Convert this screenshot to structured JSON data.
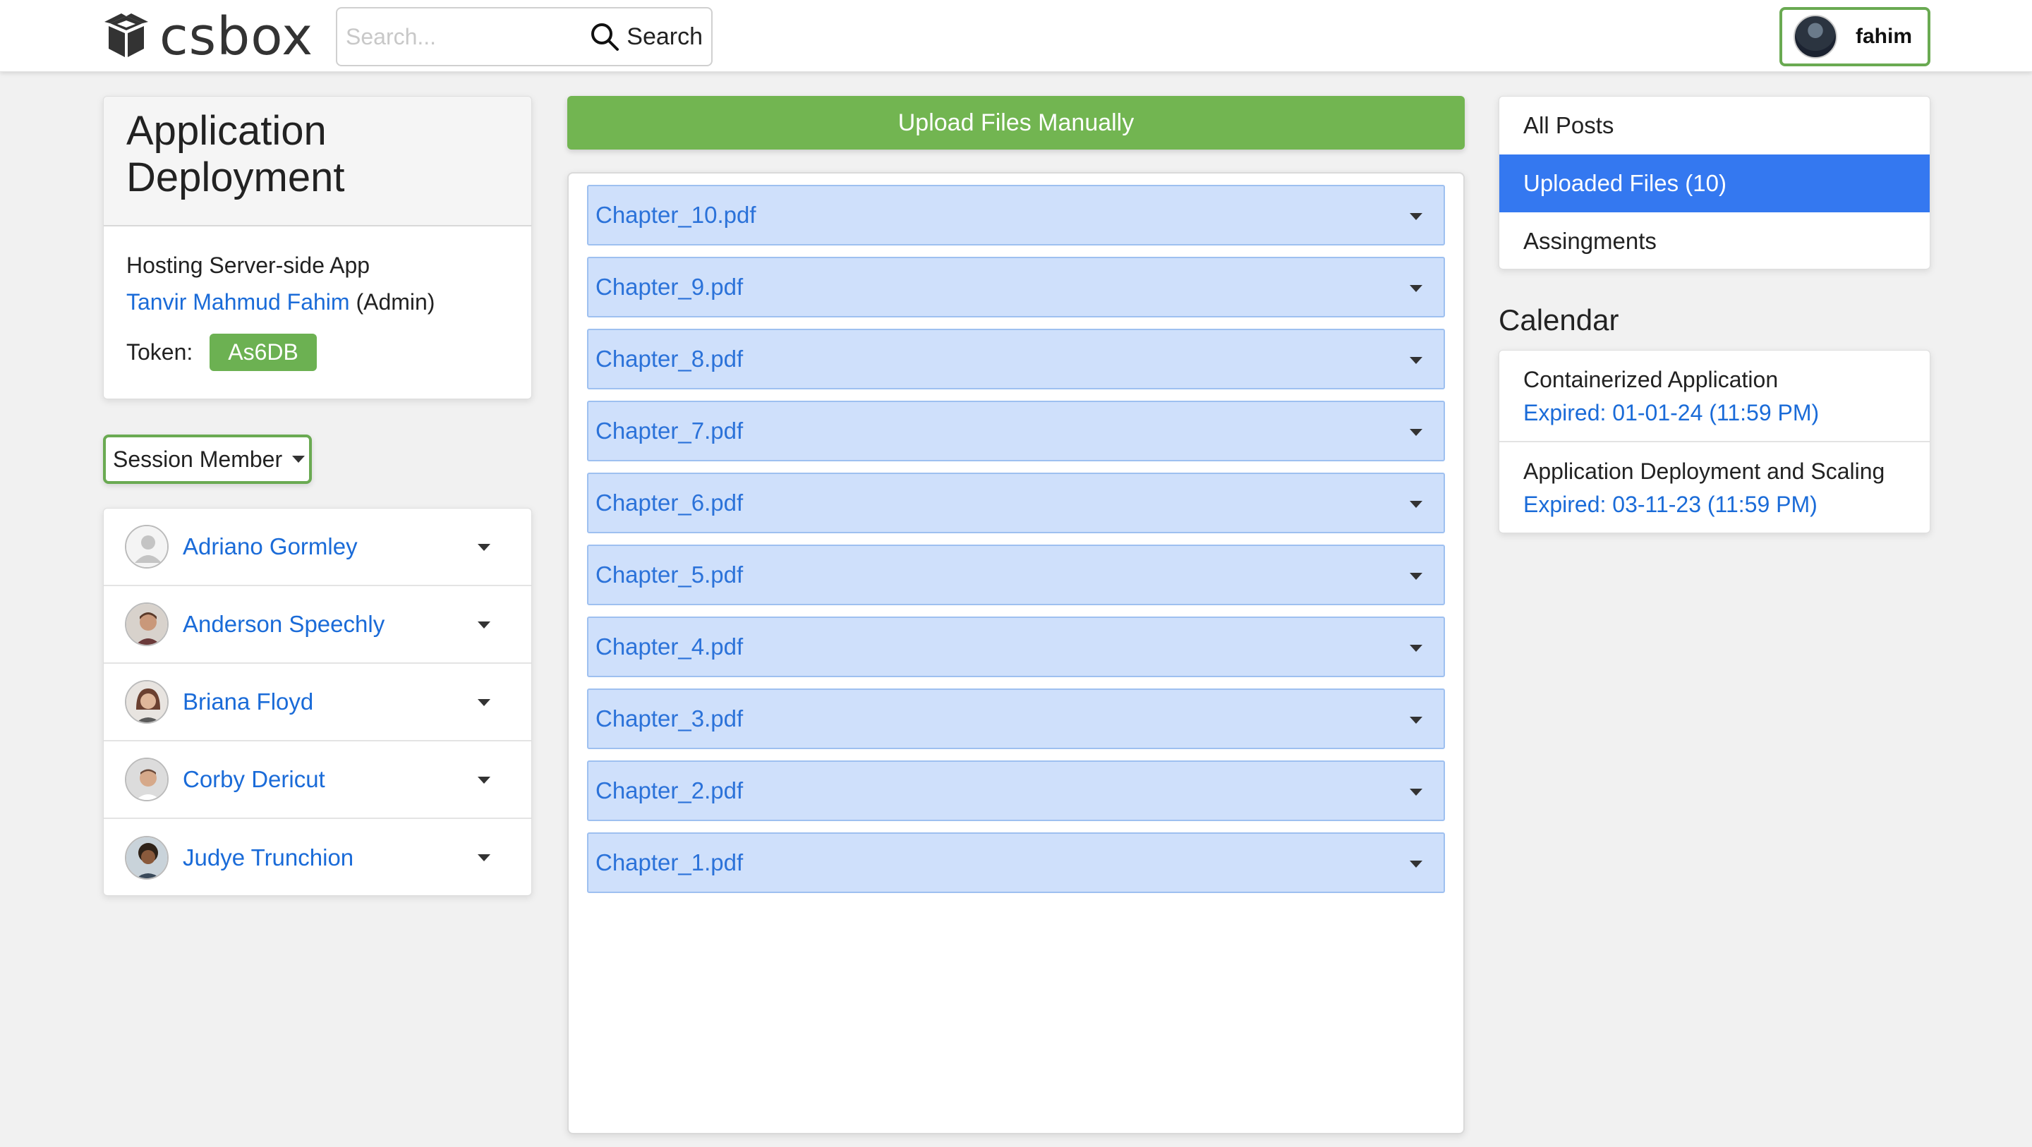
{
  "app": {
    "name": "csbox"
  },
  "search": {
    "placeholder": "Search...",
    "button_label": "Search"
  },
  "user": {
    "name": "fahim"
  },
  "course": {
    "title": "Application Deployment",
    "subtitle": "Hosting Server-side App",
    "owner_name": "Tanvir Mahmud Fahim",
    "owner_role": "(Admin)",
    "token_label": "Token:",
    "token_value": "As6DB"
  },
  "session": {
    "button_label": "Session Member",
    "members": [
      {
        "name": "Adriano Gormley",
        "avatar": "default-avatar-icon"
      },
      {
        "name": "Anderson Speechly",
        "avatar": "photo"
      },
      {
        "name": "Briana Floyd",
        "avatar": "photo"
      },
      {
        "name": "Corby Dericut",
        "avatar": "photo"
      },
      {
        "name": "Judye Trunchion",
        "avatar": "photo"
      }
    ]
  },
  "uploads": {
    "button_label": "Upload Files Manually",
    "files": [
      "Chapter_10.pdf",
      "Chapter_9.pdf",
      "Chapter_8.pdf",
      "Chapter_7.pdf",
      "Chapter_6.pdf",
      "Chapter_5.pdf",
      "Chapter_4.pdf",
      "Chapter_3.pdf",
      "Chapter_2.pdf",
      "Chapter_1.pdf"
    ]
  },
  "nav": {
    "items": [
      {
        "label": "All Posts",
        "active": false
      },
      {
        "label": "Uploaded Files (10)",
        "active": true
      },
      {
        "label": "Assingments",
        "active": false
      }
    ]
  },
  "calendar": {
    "title": "Calendar",
    "events": [
      {
        "name": "Containerized Application",
        "expiry": "Expired: 01-01-24 (11:59 PM)"
      },
      {
        "name": "Application Deployment and Scaling",
        "expiry": "Expired: 03-11-23 (11:59 PM)"
      }
    ]
  },
  "colors": {
    "accent_green": "#72b551",
    "active_blue": "#3478f0",
    "link_blue": "#1a6bd8",
    "file_row_bg": "#cfe0fb"
  }
}
